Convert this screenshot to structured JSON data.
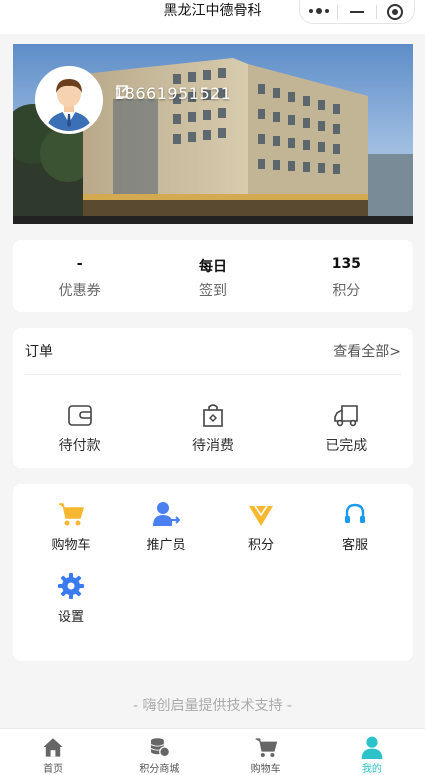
{
  "nav": {
    "title": "黑龙江中德骨科"
  },
  "profile": {
    "phone": "18661951521"
  },
  "stats": [
    {
      "value": "-",
      "label": "优惠券"
    },
    {
      "value": "每日",
      "label": "签到"
    },
    {
      "value": "135",
      "label": "积分"
    }
  ],
  "orders": {
    "title": "订单",
    "view_all": "查看全部>",
    "items": [
      {
        "label": "待付款",
        "icon": "wallet-icon"
      },
      {
        "label": "待消费",
        "icon": "shopping-bag-icon"
      },
      {
        "label": "已完成",
        "icon": "delivery-truck-icon"
      }
    ]
  },
  "tools": [
    {
      "label": "购物车",
      "icon": "shopping-cart-icon",
      "color": "#f7b731"
    },
    {
      "label": "推广员",
      "icon": "user-share-icon",
      "color": "#4a7ff0"
    },
    {
      "label": "积分",
      "icon": "diamond-icon",
      "color": "#f7b731"
    },
    {
      "label": "客服",
      "icon": "headset-icon",
      "color": "#1a9bf0"
    },
    {
      "label": "设置",
      "icon": "gear-icon",
      "color": "#3a7cf0"
    }
  ],
  "footer": {
    "support": "- 嗨创启量提供技术支持 -"
  },
  "tabbar": [
    {
      "label": "首页",
      "icon": "home-icon"
    },
    {
      "label": "积分商城",
      "icon": "coins-icon"
    },
    {
      "label": "购物车",
      "icon": "cart-icon"
    },
    {
      "label": "我的",
      "icon": "person-icon"
    }
  ],
  "colors": {
    "accent": "#2bc3c9",
    "yellow": "#f7b731",
    "blue": "#4a7ff0"
  }
}
